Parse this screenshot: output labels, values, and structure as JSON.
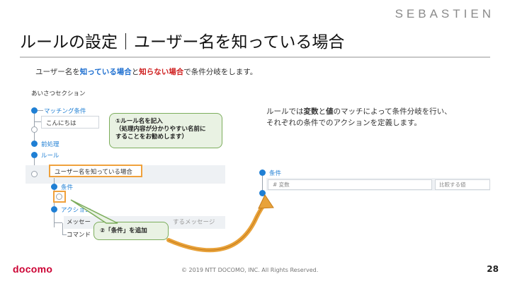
{
  "brand": "SEBASTIEN",
  "title": "ルールの設定｜ユーザー名を知っている場合",
  "subtitle": {
    "part1": "ユーザー名を",
    "hl1": "知っている場合",
    "part2": "と",
    "hl2": "知らない場合",
    "part3": "で条件分岐をします。"
  },
  "left_panel": {
    "section": "あいさつセクション",
    "matching": "マッチング条件",
    "hello_input": "こんにちは",
    "preprocess": "前処理",
    "rule": "ルール",
    "rule_name": "ユーザー名を知っている場合",
    "condition": "条件",
    "action": "アクション",
    "message": "メッセー",
    "message_placeholder": "するメッセージ",
    "command": "コマンド"
  },
  "callout1": {
    "line1": "①ルール名を記入",
    "line2": "（処理内容が分かりやすい名前に",
    "line3": "することをお勧めします）"
  },
  "callout2": {
    "text": "②「条件」を追加"
  },
  "right_desc": {
    "line1_a": "ルールでは",
    "line1_b": "変数",
    "line1_c": "と",
    "line1_d": "値",
    "line1_e": "のマッチによって条件分岐を行い、",
    "line2": "それぞれの条件でのアクションを定義します。"
  },
  "right_panel": {
    "condition": "条件",
    "var_placeholder": "# 変数",
    "value_placeholder": "比較する値"
  },
  "footer": {
    "copyright": "© 2019 NTT DOCOMO, INC. All Rights Reserved.",
    "page": "28",
    "logo": "docomo"
  },
  "colors": {
    "accent_blue": "#1f7fd4",
    "highlight_orange": "#f0a13c",
    "callout_green": "#7cad5c",
    "arrow_orange": "#e8a23a",
    "logo_red": "#cc0033"
  }
}
